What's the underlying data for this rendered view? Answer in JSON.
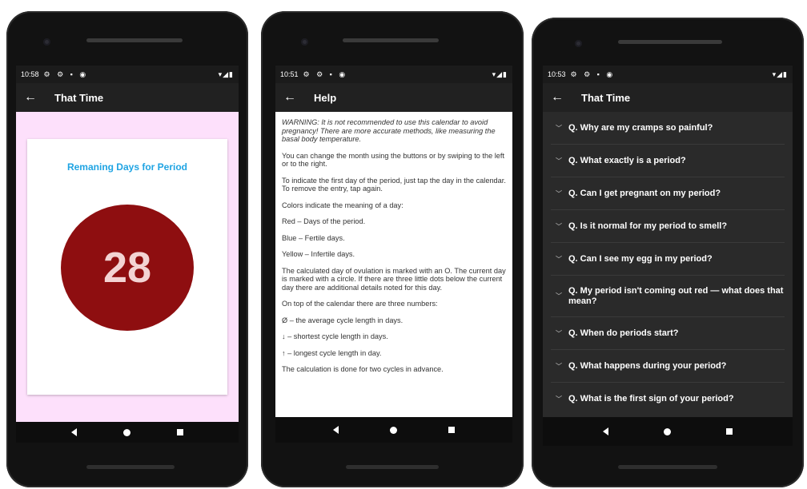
{
  "screen1": {
    "status_time": "10:58",
    "status_icons": "⚙ ⚙ ▪ ◉",
    "status_right": "▾◢▮",
    "back_icon": "←",
    "app_title": "That Time",
    "card_title": "Remaning Days for Period",
    "days_remaining": "28"
  },
  "screen2": {
    "status_time": "10:51",
    "status_icons": "⚙ ⚙ ▪ ◉",
    "status_right": "▾◢▮",
    "back_icon": "←",
    "app_title": "Help",
    "paragraphs": [
      "WARNING: It is not recommended to use this calendar to avoid pregnancy! There are more accurate methods, like measuring the basal body temperature.",
      "You can change the month using the buttons or by swiping to the left or to the right.",
      "To indicate the first day of the period, just tap the day in the calendar. To remove the entry, tap again.",
      "Colors indicate the meaning of a day:",
      "Red – Days of the period.",
      "Blue – Fertile days.",
      "Yellow – Infertile days.",
      "The calculated day of ovulation is marked with an O. The current day is marked with a circle. If there are three little dots below the current day there are additional details noted for this day.",
      "On top of the calendar there are three numbers:",
      "Ø – the average cycle length in days.",
      "↓ – shortest cycle length in days.",
      "↑ – longest cycle length in day.",
      "The calculation is done for two cycles in advance."
    ]
  },
  "screen3": {
    "status_time": "10:53",
    "status_icons": "⚙ ⚙ ▪ ◉",
    "status_right": "▾◢▮",
    "back_icon": "←",
    "app_title": "That Time",
    "chevron": "﹀",
    "questions": [
      "Q. Why are my cramps so painful?",
      "Q. What exactly is a period?",
      "Q. Can I get pregnant on my period?",
      "Q. Is it normal for my period to smell?",
      "Q. Can I see my egg in my period?",
      "Q. My period isn't coming out red — what does that mean?",
      "Q. When do periods start?",
      "Q. What happens during your period?",
      "Q. What is the first sign of your period?"
    ]
  }
}
